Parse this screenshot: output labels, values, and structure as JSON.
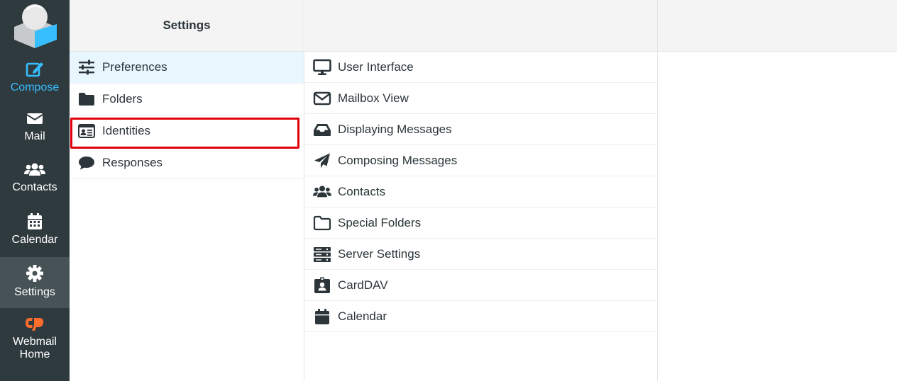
{
  "nav": {
    "compose": "Compose",
    "mail": "Mail",
    "contacts": "Contacts",
    "calendar": "Calendar",
    "settings": "Settings",
    "webmail_home_line1": "Webmail",
    "webmail_home_line2": "Home"
  },
  "settings_column": {
    "title": "Settings",
    "items": [
      {
        "label": "Preferences",
        "icon": "sliders-icon"
      },
      {
        "label": "Folders",
        "icon": "folder-icon"
      },
      {
        "label": "Identities",
        "icon": "id-card-icon"
      },
      {
        "label": "Responses",
        "icon": "comment-icon"
      }
    ]
  },
  "preferences_column": {
    "items": [
      {
        "label": "User Interface",
        "icon": "monitor-icon"
      },
      {
        "label": "Mailbox View",
        "icon": "envelope-icon"
      },
      {
        "label": "Displaying Messages",
        "icon": "inbox-icon"
      },
      {
        "label": "Composing Messages",
        "icon": "paper-plane-icon"
      },
      {
        "label": "Contacts",
        "icon": "users-icon"
      },
      {
        "label": "Special Folders",
        "icon": "folder-outline-icon"
      },
      {
        "label": "Server Settings",
        "icon": "server-icon"
      },
      {
        "label": "CardDAV",
        "icon": "address-badge-icon"
      },
      {
        "label": "Calendar",
        "icon": "calendar-icon"
      }
    ]
  },
  "colors": {
    "nav_bg": "#2f3a3f",
    "nav_active": "#475257",
    "accent": "#37beff",
    "highlight_border": "#e0000a",
    "cpanel_orange": "#ff6c2c"
  }
}
